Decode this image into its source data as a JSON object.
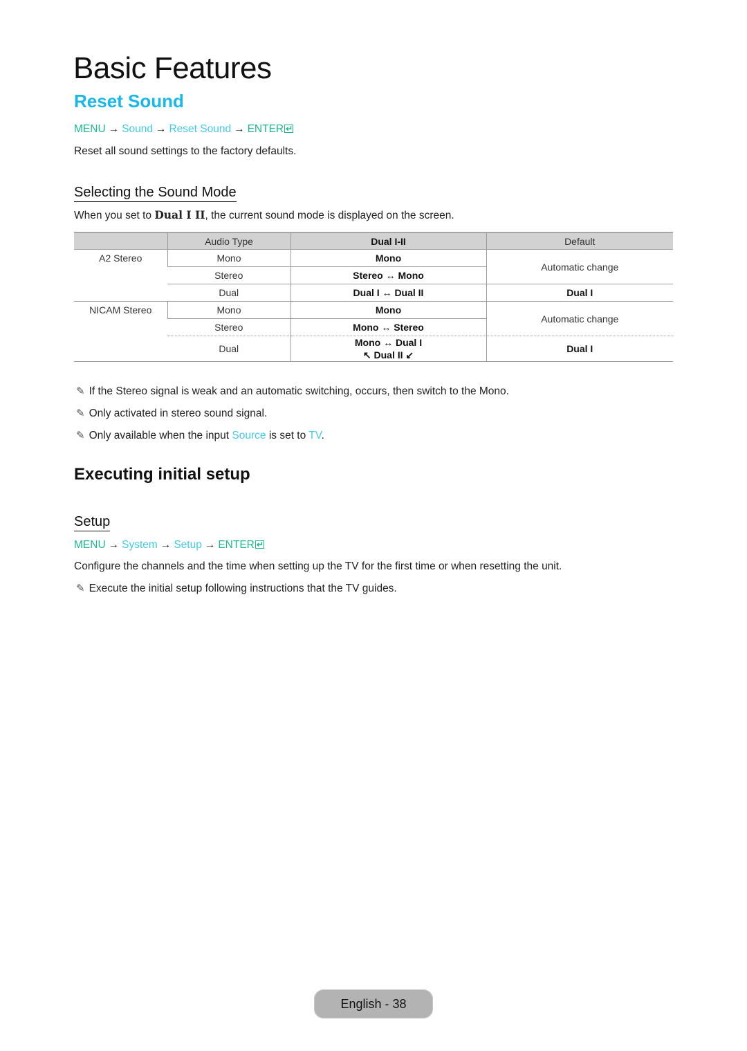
{
  "chapter_title": "Basic Features",
  "reset_sound": {
    "title": "Reset Sound",
    "path": {
      "menu": "MENU",
      "arrow": "→",
      "items": [
        "Sound",
        "Reset Sound"
      ],
      "enter": "ENTER",
      "enter_icon": "enter-icon"
    },
    "description": "Reset all sound settings to the factory defaults."
  },
  "sound_mode": {
    "title": "Selecting the Sound Mode",
    "intro_before": "When you set to ",
    "intro_bold": "Dual I II",
    "intro_after": ", the current sound mode is displayed on the screen.",
    "table": {
      "headers": [
        "",
        "Audio Type",
        "Dual I-II",
        "Default"
      ],
      "rows": [
        {
          "group": "A2 Stereo",
          "audio_type": "Mono",
          "dual": "Mono",
          "default": "Automatic change"
        },
        {
          "group": "",
          "audio_type": "Stereo",
          "dual": "Stereo ↔ Mono",
          "default": ""
        },
        {
          "group": "",
          "audio_type": "Dual",
          "dual": "Dual I ↔ Dual II",
          "default": "Dual I"
        },
        {
          "group": "NICAM Stereo",
          "audio_type": "Mono",
          "dual": "Mono",
          "default": "Automatic change"
        },
        {
          "group": "",
          "audio_type": "Stereo",
          "dual": "Mono ↔ Stereo",
          "default": ""
        },
        {
          "group": "",
          "audio_type": "Dual",
          "dual": "Mono ↔ Dual I",
          "dual_line2": "↖ Dual II ↙",
          "default": "Dual I"
        }
      ]
    },
    "notes": [
      {
        "icon": "pencil-note-icon",
        "text": "If the Stereo signal is weak and an automatic switching, occurs, then switch to the Mono."
      },
      {
        "icon": "pencil-note-icon",
        "text": "Only activated in stereo sound signal."
      },
      {
        "icon": "pencil-note-icon",
        "before": "Only available when the input ",
        "link1": "Source",
        "middle": " is set to ",
        "link2": "TV",
        "after": "."
      }
    ]
  },
  "initial_setup": {
    "title": "Executing initial setup",
    "setup": {
      "title": "Setup",
      "path": {
        "menu": "MENU",
        "arrow": "→",
        "items": [
          "System",
          "Setup"
        ],
        "enter": "ENTER",
        "enter_icon": "enter-icon"
      },
      "description": "Configure the channels and the time when setting up the TV for the first time or when resetting the unit.",
      "note": {
        "icon": "pencil-note-icon",
        "text": "Execute the initial setup following instructions that the TV guides."
      }
    }
  },
  "footer": {
    "page_label": "English - 38"
  }
}
